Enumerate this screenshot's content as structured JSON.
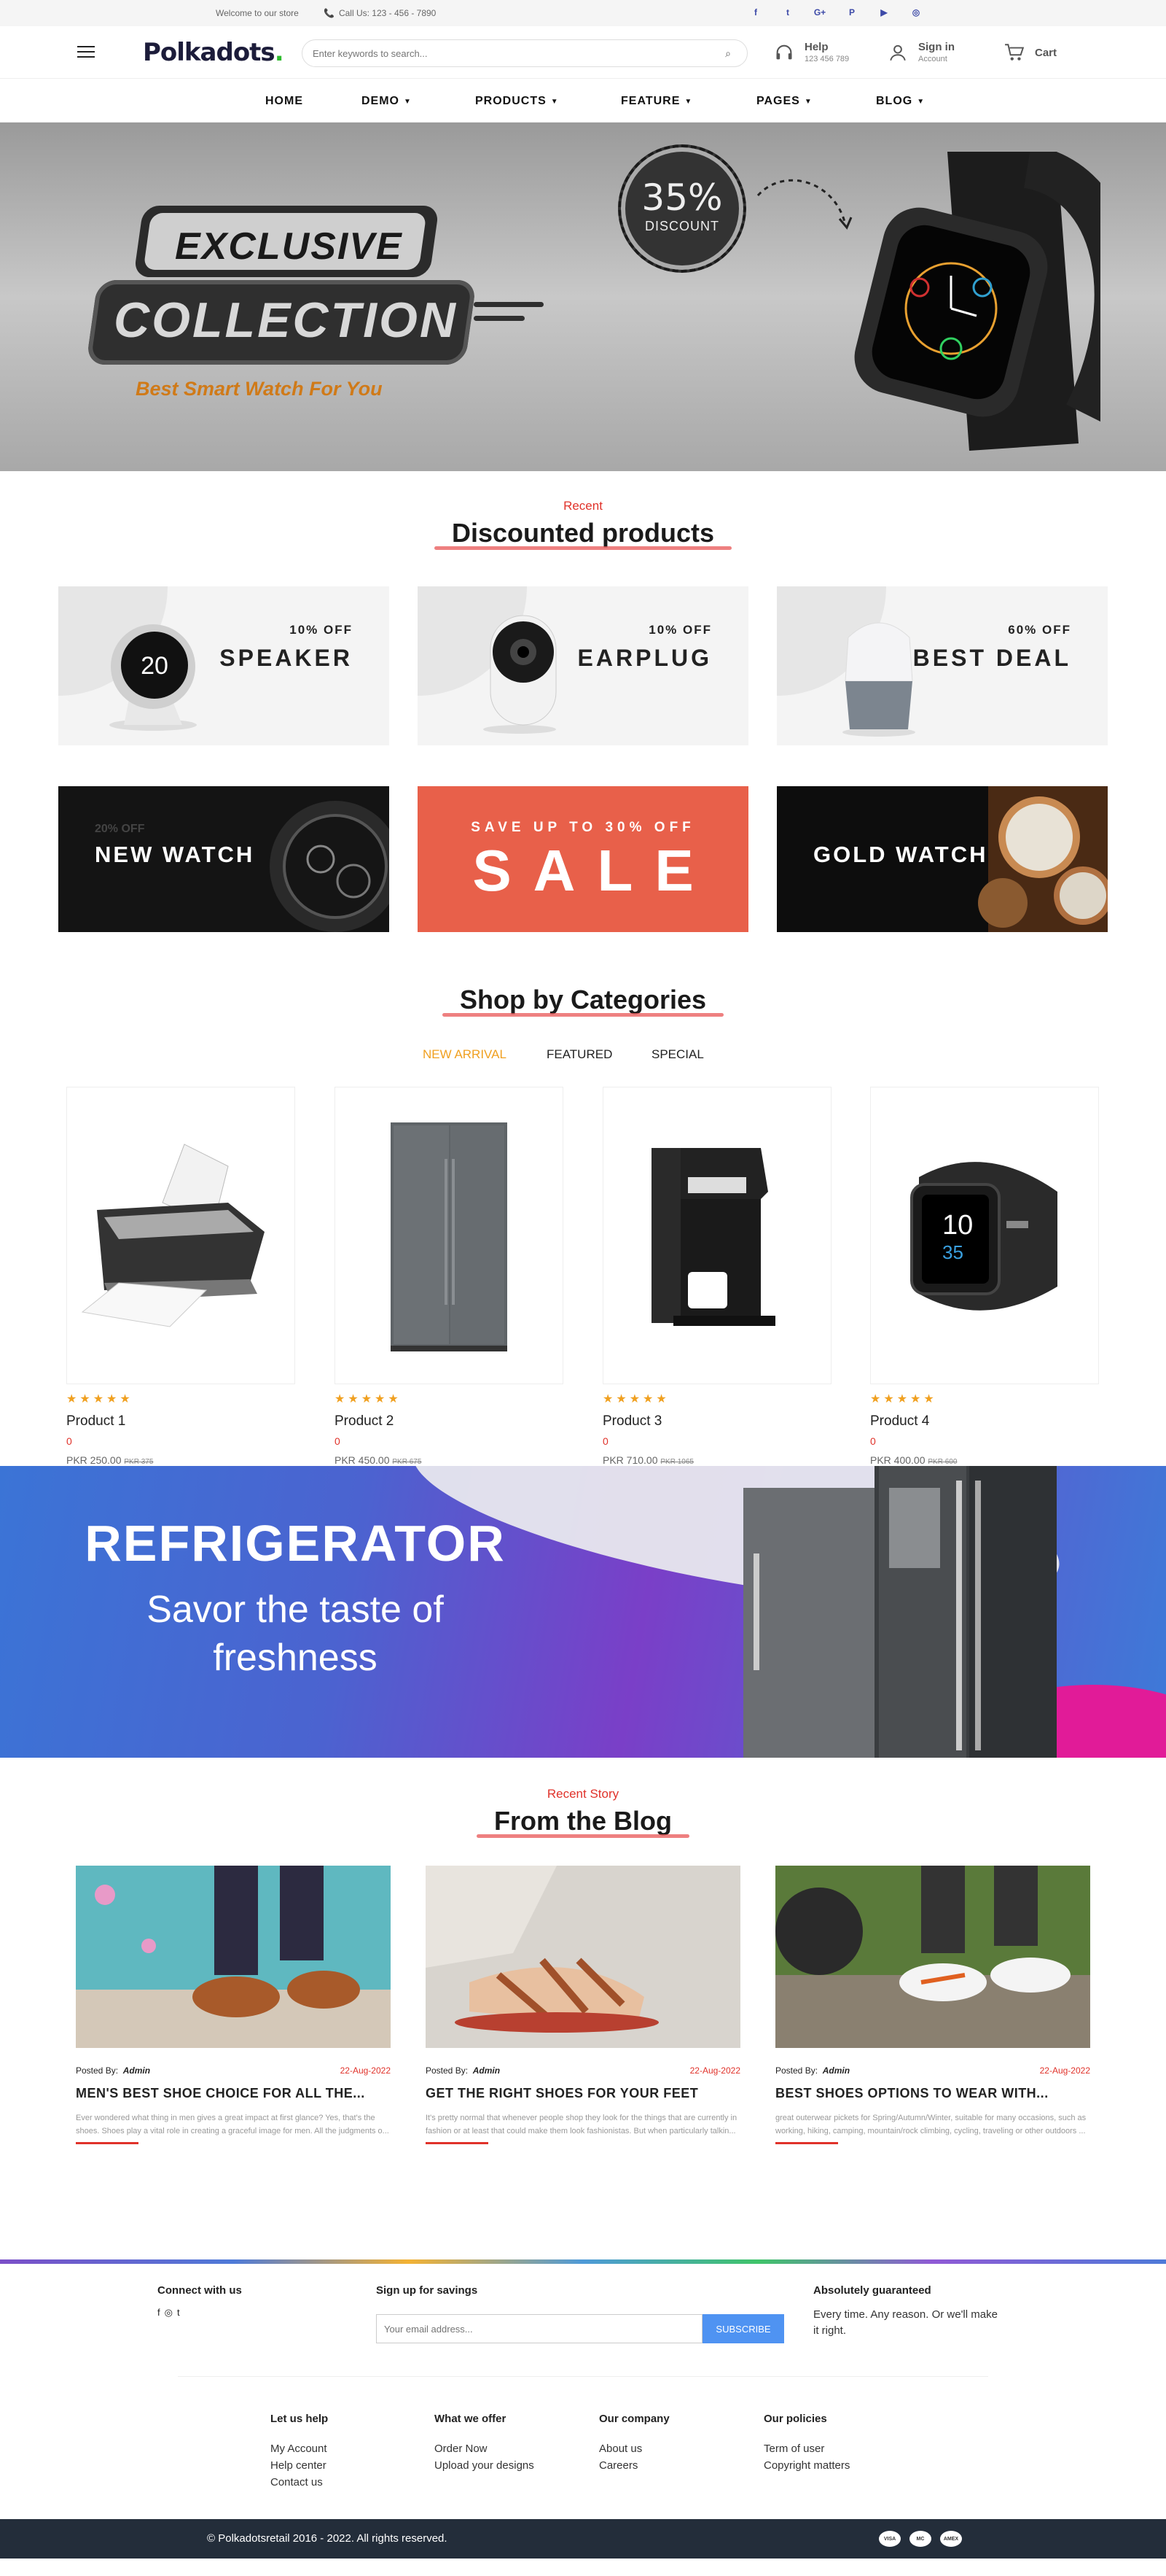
{
  "topbar": {
    "welcome": "Welcome to our store",
    "call": "Call Us: 123 - 456 - 7890",
    "social": [
      "facebook-icon",
      "twitter-icon",
      "google-plus-icon",
      "pinterest-icon",
      "youtube-icon",
      "instagram-icon"
    ]
  },
  "header": {
    "logo_main": "Polkadots",
    "logo_dot": ".",
    "search_placeholder": "Enter keywords to search...",
    "help_title": "Help",
    "help_sub": "123 456 789",
    "signin_title": "Sign in",
    "signin_sub": "Account",
    "cart": "Cart"
  },
  "nav": [
    "HOME",
    "DEMO",
    "PRODUCTS",
    "FEATURE",
    "PAGES",
    "BLOG"
  ],
  "hero": {
    "line1": "EXCLUSIVE",
    "line2": "COLLECTION",
    "tagline": "Best Smart Watch For You",
    "discount_pct": "35%",
    "discount_label": "DISCOUNT"
  },
  "discounted": {
    "kicker": "Recent",
    "title": "Discounted products",
    "offers": [
      {
        "pct": "10% OFF",
        "name": "SPEAKER"
      },
      {
        "pct": "10% OFF",
        "name": "EARPLUG"
      },
      {
        "pct": "60% OFF",
        "name": "BEST DEAL"
      }
    ],
    "new_watch_pct": "20% OFF",
    "new_watch": "NEW WATCH",
    "sale_top": "SAVE UP TO 30% OFF",
    "sale_big": "SALE",
    "gold_watch": "GOLD WATCH"
  },
  "categories": {
    "title": "Shop by Categories",
    "tabs": [
      "NEW ARRIVAL",
      "FEATURED",
      "SPECIAL"
    ],
    "products": [
      {
        "name": "Product 1",
        "count": "0",
        "price": "PKR 250.00",
        "old": "PKR 375"
      },
      {
        "name": "Product 2",
        "count": "0",
        "price": "PKR 450.00",
        "old": "PKR 675"
      },
      {
        "name": "Product 3",
        "count": "0",
        "price": "PKR 710.00",
        "old": "PKR 1065"
      },
      {
        "name": "Product 4",
        "count": "0",
        "price": "PKR 400.00",
        "old": "PKR 600"
      }
    ],
    "stars": "★★★★★",
    "rating": 5
  },
  "banner": {
    "title": "REFRIGERATOR",
    "sub1": "Savor the taste of",
    "sub2": "freshness"
  },
  "blog": {
    "kicker": "Recent Story",
    "title": "From the Blog",
    "posted_by": "Posted By:",
    "author": "Admin",
    "posts": [
      {
        "date": "22-Aug-2022",
        "title": "MEN'S BEST SHOE CHOICE FOR ALL THE...",
        "excerpt": "Ever wondered what thing in men gives a great impact at first glance? Yes, that's the shoes. Shoes play a vital role in creating a graceful image for men. All the judgments o..."
      },
      {
        "date": "22-Aug-2022",
        "title": "GET THE RIGHT SHOES FOR YOUR FEET",
        "excerpt": "It's pretty normal that whenever people shop they look for the things that are currently in fashion or at least that could make them look fashionistas. But when particularly talkin..."
      },
      {
        "date": "22-Aug-2022",
        "title": "BEST SHOES OPTIONS TO WEAR WITH...",
        "excerpt": "great outerwear pickets for Spring/Autumn/Winter, suitable for many occasions, such as working, hiking, camping, mountain/rock climbing, cycling, traveling or other outdoors ..."
      }
    ]
  },
  "footer": {
    "connect": "Connect with us",
    "signup": "Sign up for savings",
    "email_placeholder": "Your email address...",
    "subscribe": "SUBSCRIBE",
    "guarantee_title": "Absolutely guaranteed",
    "guarantee_text": "Every time. Any reason. Or we'll make it right.",
    "cols": [
      {
        "title": "Let us help",
        "links": [
          "My Account",
          "Help center",
          "Contact us"
        ]
      },
      {
        "title": "What we offer",
        "links": [
          "Order Now",
          "Upload your designs"
        ]
      },
      {
        "title": "Our company",
        "links": [
          "About us",
          "Careers"
        ]
      },
      {
        "title": "Our policies",
        "links": [
          "Term of user",
          "Copyright matters"
        ]
      }
    ],
    "copyright": "© Polkadotsretail 2016 - 2022. All rights reserved.",
    "cards": [
      "VISA",
      "MC",
      "AMEX"
    ]
  }
}
